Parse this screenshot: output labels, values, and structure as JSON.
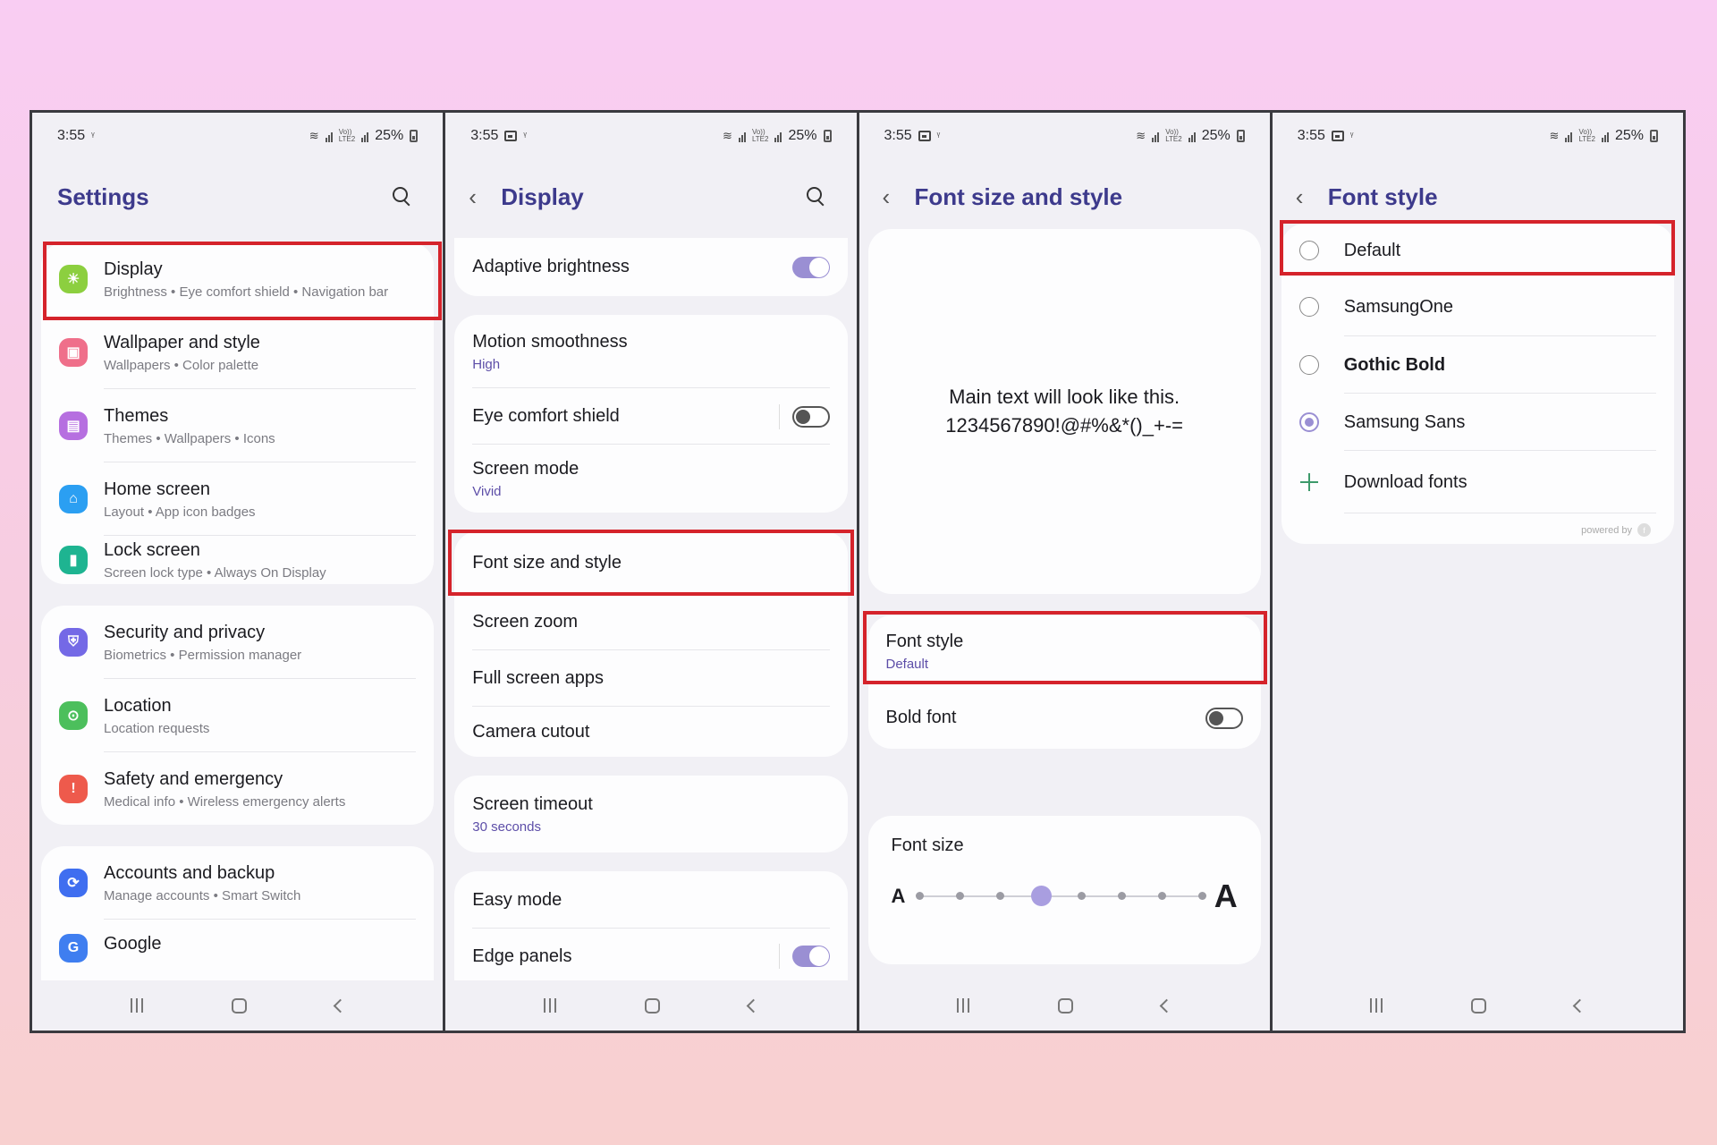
{
  "colors": {
    "accent": "#3d3a8c",
    "highlight_border": "#d5232b",
    "toggle_on": "#9a8fd3",
    "subtext_accent": "#5d4ea8"
  },
  "status": {
    "time": "3:55",
    "battery": "25%",
    "volte_lines": [
      "Vo))",
      "LTE2"
    ]
  },
  "settings": {
    "title": "Settings",
    "groups": [
      [
        {
          "label": "Display",
          "sub": "Brightness  •  Eye comfort shield  •  Navigation bar",
          "icon": "sun-icon",
          "color": "#8ccf3f",
          "glyph": "☀"
        },
        {
          "label": "Wallpaper and style",
          "sub": "Wallpapers  •  Color palette",
          "icon": "wallpaper-icon",
          "color": "#ef6f8a",
          "glyph": "▣"
        },
        {
          "label": "Themes",
          "sub": "Themes  •  Wallpapers  •  Icons",
          "icon": "themes-icon",
          "color": "#b66fe0",
          "glyph": "▤"
        },
        {
          "label": "Home screen",
          "sub": "Layout  •  App icon badges",
          "icon": "home-icon",
          "color": "#2b9ff2",
          "glyph": "⌂"
        },
        {
          "label": "Lock screen",
          "sub": "Screen lock type  •  Always On Display",
          "icon": "lock-icon",
          "color": "#1eb491",
          "glyph": "🔒"
        }
      ],
      [
        {
          "label": "Security and privacy",
          "sub": "Biometrics  •  Permission manager",
          "icon": "shield-icon",
          "color": "#7469e6",
          "glyph": "⛨"
        },
        {
          "label": "Location",
          "sub": "Location requests",
          "icon": "location-pin-icon",
          "color": "#4cbf5c",
          "glyph": "⊙"
        },
        {
          "label": "Safety and emergency",
          "sub": "Medical info  •  Wireless emergency alerts",
          "icon": "emergency-icon",
          "color": "#ee5a4c",
          "glyph": "!"
        }
      ],
      [
        {
          "label": "Accounts and backup",
          "sub": "Manage accounts  •  Smart Switch",
          "icon": "sync-icon",
          "color": "#3f6ef0",
          "glyph": "⟳"
        },
        {
          "label": "Google",
          "sub": "",
          "icon": "google-icon",
          "color": "#3f7ef0",
          "glyph": "G"
        }
      ]
    ]
  },
  "display": {
    "title": "Display",
    "groups": [
      [
        {
          "label": "Adaptive brightness",
          "sub": "",
          "toggle": "on"
        }
      ],
      [
        {
          "label": "Motion smoothness",
          "sub": "High"
        },
        {
          "label": "Eye comfort shield",
          "sub": "",
          "toggle": "off"
        },
        {
          "label": "Screen mode",
          "sub": "Vivid"
        }
      ],
      [
        {
          "label": "Font size and style",
          "sub": ""
        },
        {
          "label": "Screen zoom",
          "sub": ""
        },
        {
          "label": "Full screen apps",
          "sub": ""
        },
        {
          "label": "Camera cutout",
          "sub": ""
        }
      ],
      [
        {
          "label": "Screen timeout",
          "sub": "30 seconds"
        }
      ],
      [
        {
          "label": "Easy mode",
          "sub": ""
        },
        {
          "label": "Edge panels",
          "sub": "",
          "toggle": "on"
        }
      ]
    ]
  },
  "font_size_style": {
    "title": "Font size and style",
    "preview_line1": "Main text will look like this.",
    "preview_line2": "1234567890!@#%&*()_+-=",
    "font_style_label": "Font style",
    "font_style_value": "Default",
    "bold_font_label": "Bold font",
    "bold_font_toggle": "off",
    "font_size_label": "Font size",
    "font_size_small_glyph": "A",
    "font_size_large_glyph": "A",
    "font_size_steps": 8,
    "font_size_selected_step": 4
  },
  "font_style": {
    "title": "Font style",
    "options": [
      {
        "label": "Default",
        "selected": false,
        "bold": false
      },
      {
        "label": "SamsungOne",
        "selected": false,
        "bold": false
      },
      {
        "label": "Gothic Bold",
        "selected": false,
        "bold": true
      },
      {
        "label": "Samsung Sans",
        "selected": true,
        "bold": false
      }
    ],
    "download_label": "Download fonts",
    "powered_by": "powered by"
  }
}
